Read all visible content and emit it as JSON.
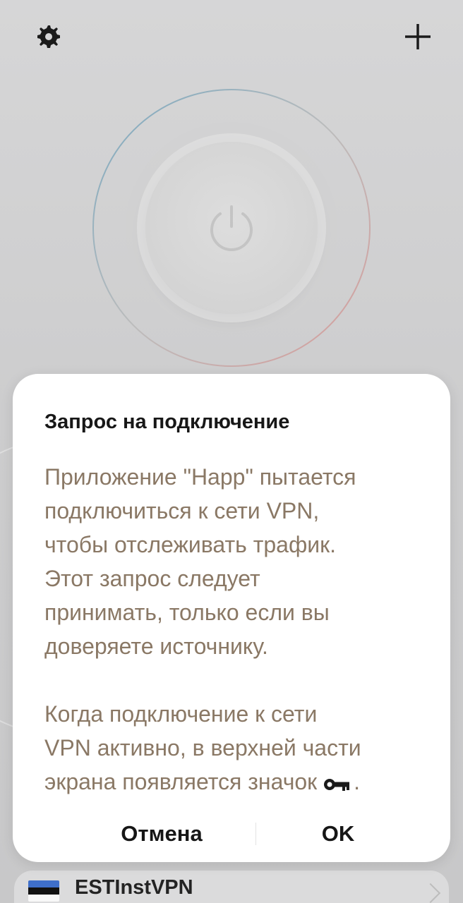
{
  "toolbar": {
    "settings_icon": "gear-icon",
    "add_icon": "plus-icon"
  },
  "vpn": {
    "power_icon": "power-icon"
  },
  "dialog": {
    "title": "Запрос на подключение",
    "paragraph1_lines": [
      "Приложение \"Happ\" пытается",
      "подключиться к сети VPN,",
      "чтобы отслеживать трафик.",
      "Этот запрос следует",
      "принимать, только если вы",
      "доверяете источнику."
    ],
    "paragraph2_lines": [
      "Когда подключение к сети",
      "VPN активно, в верхней части",
      "экрана появляется значок",
      "."
    ],
    "key_icon": "key-icon",
    "cancel_label": "Отмена",
    "ok_label": "OK"
  },
  "server_list": {
    "items": [
      {
        "flag": "estonia-flag",
        "name": "ESTInstVPN"
      }
    ]
  },
  "colors": {
    "background": "#d6d6d7",
    "dialog_bg": "#ffffff",
    "dialog_text": "#8a7865",
    "primary_text": "#171717"
  }
}
